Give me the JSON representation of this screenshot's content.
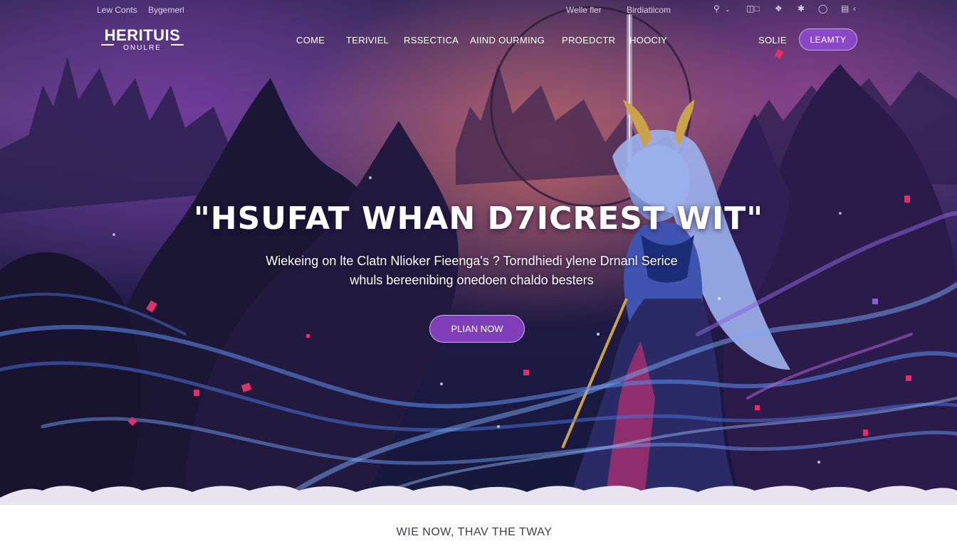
{
  "utility": {
    "links": [
      "Lew Conts",
      "Bygemerl"
    ],
    "right_links": [
      "Welle fler",
      "Birdiatiicom"
    ],
    "icons": [
      "search-icon",
      "chevron-down-icon",
      "window-icon",
      "chat-icon",
      "grid-icon",
      "cloud-icon",
      "card-icon",
      "chevron-left-icon"
    ]
  },
  "logo": {
    "line1": "HERITUIS",
    "line2": "ONULRE"
  },
  "nav": {
    "items": [
      "COME",
      "TERIVIEL",
      "RSSECTICA",
      "AIIND OURMING",
      "PROEDCTR",
      "HOOCIY"
    ],
    "right_link": "SOLIE",
    "cta_label": "LEAMTY"
  },
  "hero": {
    "headline": "\"HSUFAT WHAN D7ICREST WIT\"",
    "subtitle_line1": "Wiekeing on lte Clatn Nlioker Fieenga's ? Torndhiedi ylene Drnanl Serice",
    "subtitle_line2": "whuls bereenibing onedoen chaldo besters",
    "cta_label": "PLIAN NOW"
  },
  "footer_strip": {
    "text": "WIE NOW, THAV THE TWAY"
  },
  "colors": {
    "accent": "#8a48c6",
    "cta": "#7e3fb9",
    "hero_dark": "#15183b"
  }
}
